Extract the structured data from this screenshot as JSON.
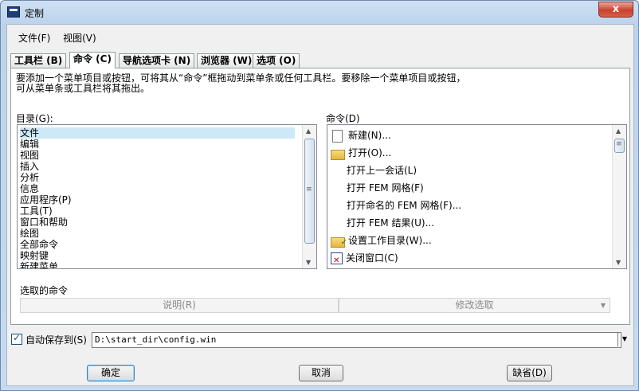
{
  "window": {
    "title": "定制",
    "close_glyph": "x"
  },
  "menu": [
    "文件(F)",
    "视图(V)"
  ],
  "tabs": [
    {
      "label": "工具栏 (B)"
    },
    {
      "label": "命令 (C)"
    },
    {
      "label": "导航选项卡 (N)"
    },
    {
      "label": "浏览器 (W)"
    },
    {
      "label": "选项 (O)"
    }
  ],
  "hint": {
    "line1": "要添加一个菜单项目或按钮，可将其从“命令”框拖动到菜单条或任何工具栏。要移除一个菜单项目或按钮，",
    "line2": "可从菜单条或工具栏将其拖出。"
  },
  "catalog": {
    "label": "目录(G):",
    "items": [
      "文件",
      "编辑",
      "视图",
      "插入",
      "分析",
      "信息",
      "应用程序(P)",
      "工具(T)",
      "窗口和帮助",
      "绘图",
      "全部命令",
      "映射键",
      "新建菜单"
    ]
  },
  "commands": {
    "label": "命令(D)",
    "items": [
      {
        "label": "新建(N)...",
        "icon": "new-document-icon"
      },
      {
        "label": "打开(O)...",
        "icon": "open-folder-icon"
      },
      {
        "label": "打开上一会话(L)",
        "icon": ""
      },
      {
        "label": "打开 FEM 网格(F)",
        "icon": ""
      },
      {
        "label": "打开命名的 FEM 网格(F)...",
        "icon": ""
      },
      {
        "label": "打开 FEM 结果(U)...",
        "icon": ""
      },
      {
        "label": "设置工作目录(W)...",
        "icon": "working-directory-icon"
      },
      {
        "label": "关闭窗口(C)",
        "icon": "close-window-icon"
      }
    ]
  },
  "selected": {
    "label": "选取的命令",
    "describe_button": "说明(R)",
    "modify_button": "修改选取"
  },
  "autosave": {
    "label": "自动保存到(S)",
    "checked": true,
    "path": "D:\\start_dir\\config.win"
  },
  "buttons": {
    "ok": "确定",
    "cancel": "取消",
    "default": "缺省(D)"
  }
}
